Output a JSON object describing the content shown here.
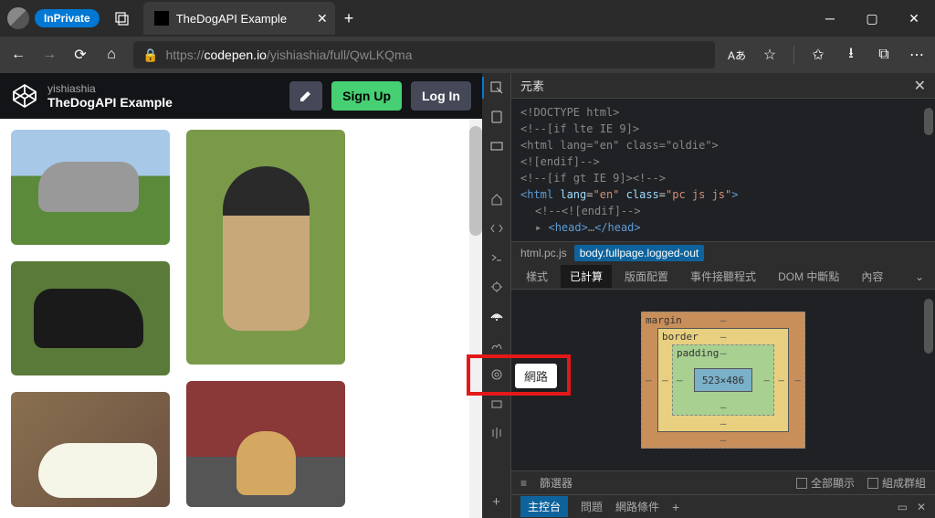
{
  "titlebar": {
    "inprivate_label": "InPrivate",
    "tab_title": "TheDogAPI Example"
  },
  "addressbar": {
    "url_prefix": "https://",
    "url_host": "codepen.io",
    "url_path": "/yishiashia/full/QwLKQma",
    "lang_indicator": "Aあ"
  },
  "codepen": {
    "user": "yishiashia",
    "title": "TheDogAPI Example",
    "signup_label": "Sign Up",
    "login_label": "Log In"
  },
  "devtools": {
    "panel_title": "元素",
    "network_tooltip": "網路",
    "code_lines": [
      "<!DOCTYPE html>",
      "<!--[if lte IE 9]>",
      "<html lang=\"en\" class=\"oldie\">",
      "<![endif]-->",
      "<!--[if gt IE 9]><!-->",
      "<html lang=\"en\" class=\"pc js js\">",
      "<!--<![endif]-->",
      "<head>…</head>"
    ],
    "breadcrumb": {
      "item1": "html.pc.js",
      "item2": "body.fullpage.logged-out"
    },
    "style_tabs": {
      "styles": "樣式",
      "computed": "已計算",
      "layout": "版面配置",
      "events": "事件接聽程式",
      "dom_breakpoints": "DOM 中斷點",
      "properties": "內容"
    },
    "box_model": {
      "margin": "margin",
      "border": "border",
      "padding": "padding",
      "content": "523×486",
      "dash": "–"
    },
    "filter": {
      "label": "篩選器",
      "show_all": "全部顯示",
      "group": "組成群組"
    },
    "console": {
      "main": "主控台",
      "issues": "問題",
      "network_conditions": "網路條件"
    }
  }
}
